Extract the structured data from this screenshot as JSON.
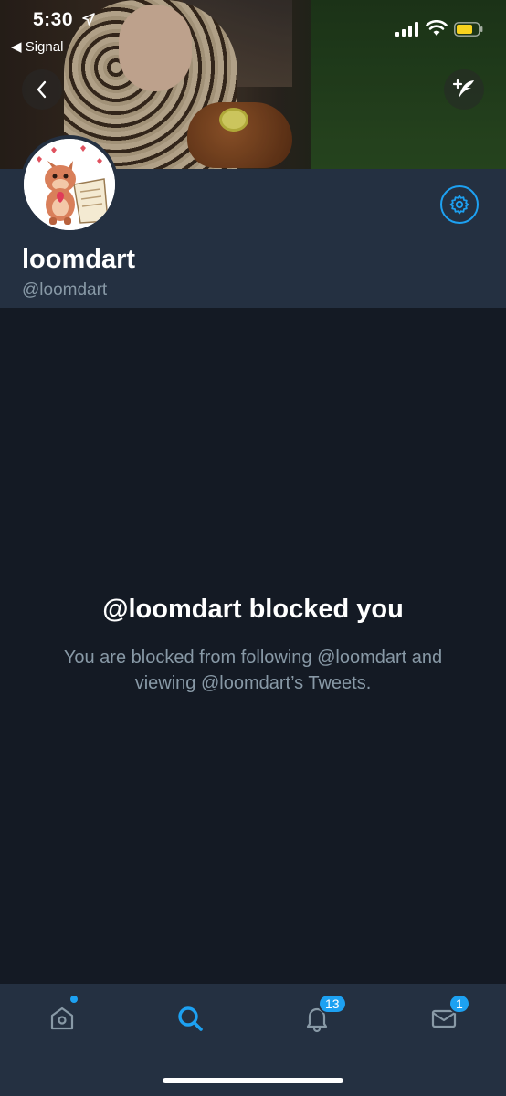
{
  "status_bar": {
    "time": "5:30",
    "back_app": "◀ Signal"
  },
  "profile": {
    "display_name": "loomdart",
    "handle": "@loomdart"
  },
  "blocked": {
    "title": "@loomdart blocked you",
    "body": "You are blocked from following @loomdart and viewing @loomdart’s Tweets."
  },
  "tabbar": {
    "items": [
      {
        "name": "home",
        "icon": "home-icon"
      },
      {
        "name": "search",
        "icon": "search-icon",
        "active": true
      },
      {
        "name": "notifications",
        "icon": "bell-icon",
        "badge": "13"
      },
      {
        "name": "messages",
        "icon": "mail-icon",
        "badge": "1"
      }
    ]
  },
  "colors": {
    "accent": "#1da1f2",
    "background": "#141a24",
    "panel": "#243041",
    "muted_text": "#8899a6"
  }
}
